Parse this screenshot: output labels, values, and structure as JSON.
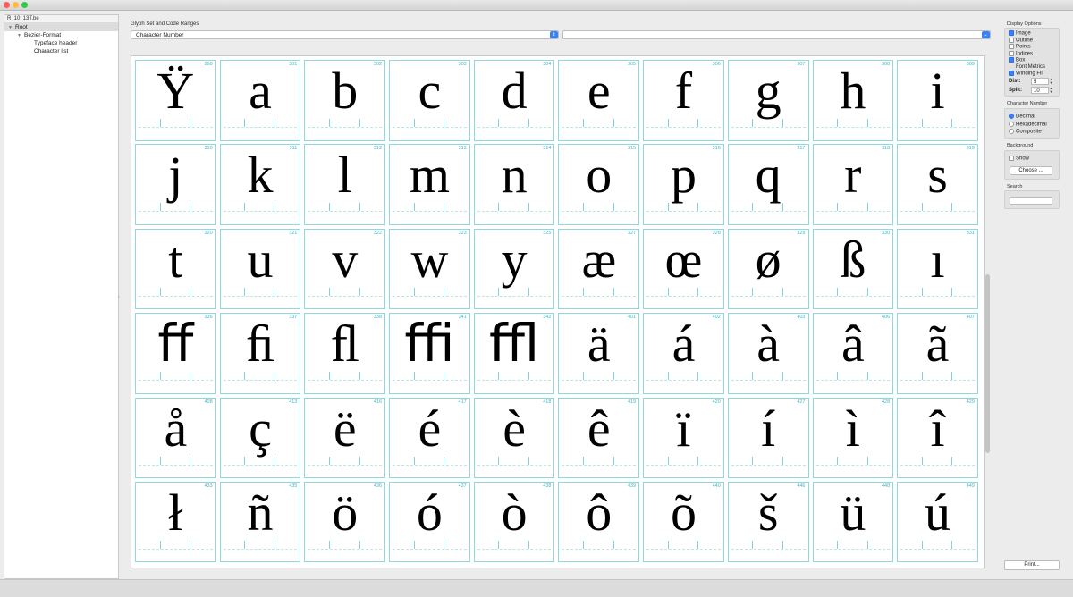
{
  "window": {
    "controls": [
      "close",
      "minimize",
      "zoom"
    ]
  },
  "tree": {
    "file": "R_10_13T.be",
    "items": [
      {
        "label": "Root",
        "level": 0,
        "expanded": true,
        "selected": true
      },
      {
        "label": "Bezier-Format",
        "level": 1,
        "expanded": true,
        "selected": false
      },
      {
        "label": "Typeface header",
        "level": 2,
        "selected": false
      },
      {
        "label": "Character list",
        "level": 2,
        "selected": false
      }
    ]
  },
  "glyph_set": {
    "label": "Glyph Set and Code Ranges",
    "primary_select": "Character Number",
    "secondary_select": ""
  },
  "glyphs": [
    {
      "num": "268",
      "char": "Ÿ"
    },
    {
      "num": "301",
      "char": "a"
    },
    {
      "num": "302",
      "char": "b"
    },
    {
      "num": "303",
      "char": "c"
    },
    {
      "num": "304",
      "char": "d"
    },
    {
      "num": "305",
      "char": "e"
    },
    {
      "num": "306",
      "char": "f"
    },
    {
      "num": "307",
      "char": "g"
    },
    {
      "num": "308",
      "char": "h"
    },
    {
      "num": "309",
      "char": "i"
    },
    {
      "num": "310",
      "char": "j"
    },
    {
      "num": "311",
      "char": "k"
    },
    {
      "num": "312",
      "char": "l"
    },
    {
      "num": "313",
      "char": "m"
    },
    {
      "num": "314",
      "char": "n"
    },
    {
      "num": "315",
      "char": "o"
    },
    {
      "num": "316",
      "char": "p"
    },
    {
      "num": "317",
      "char": "q"
    },
    {
      "num": "318",
      "char": "r"
    },
    {
      "num": "319",
      "char": "s"
    },
    {
      "num": "320",
      "char": "t"
    },
    {
      "num": "321",
      "char": "u"
    },
    {
      "num": "322",
      "char": "v"
    },
    {
      "num": "323",
      "char": "w"
    },
    {
      "num": "325",
      "char": "y"
    },
    {
      "num": "327",
      "char": "æ"
    },
    {
      "num": "328",
      "char": "œ"
    },
    {
      "num": "329",
      "char": "ø"
    },
    {
      "num": "330",
      "char": "ß"
    },
    {
      "num": "331",
      "char": "ı"
    },
    {
      "num": "336",
      "char": "ﬀ"
    },
    {
      "num": "337",
      "char": "ﬁ"
    },
    {
      "num": "338",
      "char": "ﬂ"
    },
    {
      "num": "341",
      "char": "ﬃ"
    },
    {
      "num": "342",
      "char": "ﬄ"
    },
    {
      "num": "401",
      "char": "ä"
    },
    {
      "num": "402",
      "char": "á"
    },
    {
      "num": "403",
      "char": "à"
    },
    {
      "num": "406",
      "char": "â"
    },
    {
      "num": "407",
      "char": "ã"
    },
    {
      "num": "408",
      "char": "å"
    },
    {
      "num": "413",
      "char": "ç"
    },
    {
      "num": "416",
      "char": "ë"
    },
    {
      "num": "417",
      "char": "é"
    },
    {
      "num": "418",
      "char": "è"
    },
    {
      "num": "419",
      "char": "ê"
    },
    {
      "num": "420",
      "char": "ï"
    },
    {
      "num": "427",
      "char": "í"
    },
    {
      "num": "428",
      "char": "ì"
    },
    {
      "num": "429",
      "char": "î"
    },
    {
      "num": "433",
      "char": "ł"
    },
    {
      "num": "435",
      "char": "ñ"
    },
    {
      "num": "436",
      "char": "ö"
    },
    {
      "num": "437",
      "char": "ó"
    },
    {
      "num": "438",
      "char": "ò"
    },
    {
      "num": "439",
      "char": "ô"
    },
    {
      "num": "440",
      "char": "õ"
    },
    {
      "num": "446",
      "char": "š"
    },
    {
      "num": "448",
      "char": "ü"
    },
    {
      "num": "449",
      "char": "ú"
    }
  ],
  "display_options": {
    "title": "Display Options",
    "items": [
      {
        "label": "Image",
        "checked": true
      },
      {
        "label": "Outline",
        "checked": false
      },
      {
        "label": "Points",
        "checked": false
      },
      {
        "label": "Indices",
        "checked": false
      },
      {
        "label": "Box",
        "checked": true
      },
      {
        "label": "Font Metrics",
        "checked": false
      },
      {
        "label": "Winding Fill",
        "checked": true
      }
    ],
    "dist_label": "Dist:",
    "dist_value": "5",
    "split_label": "Split:",
    "split_value": "10"
  },
  "character_number": {
    "title": "Character Number",
    "options": [
      {
        "label": "Decimal",
        "selected": true
      },
      {
        "label": "Hexadecimal",
        "selected": false
      },
      {
        "label": "Composite",
        "selected": false
      }
    ]
  },
  "background": {
    "title": "Background",
    "show_label": "Show",
    "show_checked": false,
    "choose_label": "Choose ..."
  },
  "search": {
    "title": "Search",
    "value": ""
  },
  "print_label": "Print..."
}
